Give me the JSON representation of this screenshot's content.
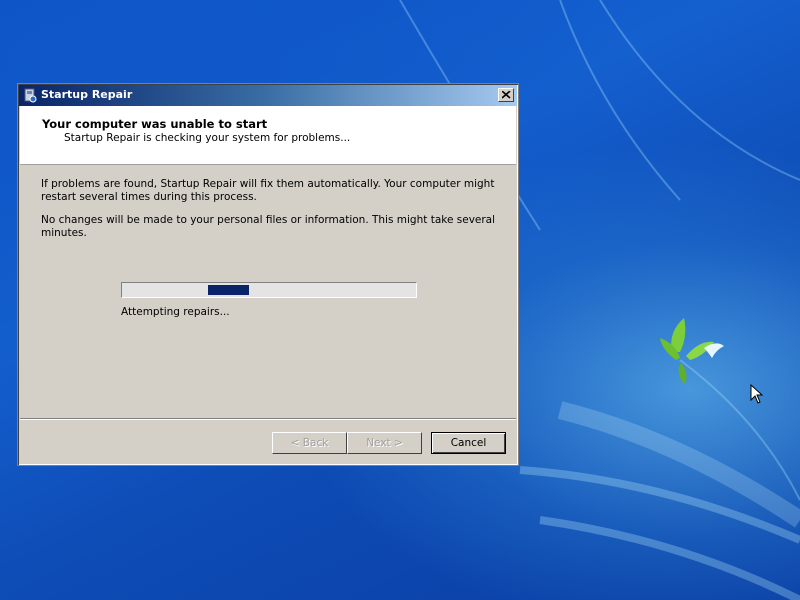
{
  "window": {
    "title": "Startup Repair",
    "close_label": "X"
  },
  "header": {
    "title": "Your computer was unable to start",
    "subtitle": "Startup Repair is checking your system for problems..."
  },
  "content": {
    "paragraph1": "If problems are found, Startup Repair will fix them automatically. Your computer might restart several times during this process.",
    "paragraph2": "No changes will be made to your personal files or information. This might take several minutes."
  },
  "progress": {
    "state": "indeterminate marquee",
    "segment_start": 0.29,
    "segment_end": 0.43,
    "status": "Attempting repairs..."
  },
  "buttons": {
    "back": "< Back",
    "next": "Next >",
    "cancel": "Cancel",
    "back_enabled": false,
    "next_enabled": false
  },
  "colors": {
    "desktop": "#0b52c6",
    "titlebar": "#0a246a",
    "dialog": "#d4d0c8",
    "progress_fill": "#0a246a"
  },
  "icons": {
    "title_icon": "startup-repair-icon",
    "cursor": "mouse-pointer-icon",
    "wallpaper_logo": "windows-bird-logo"
  }
}
